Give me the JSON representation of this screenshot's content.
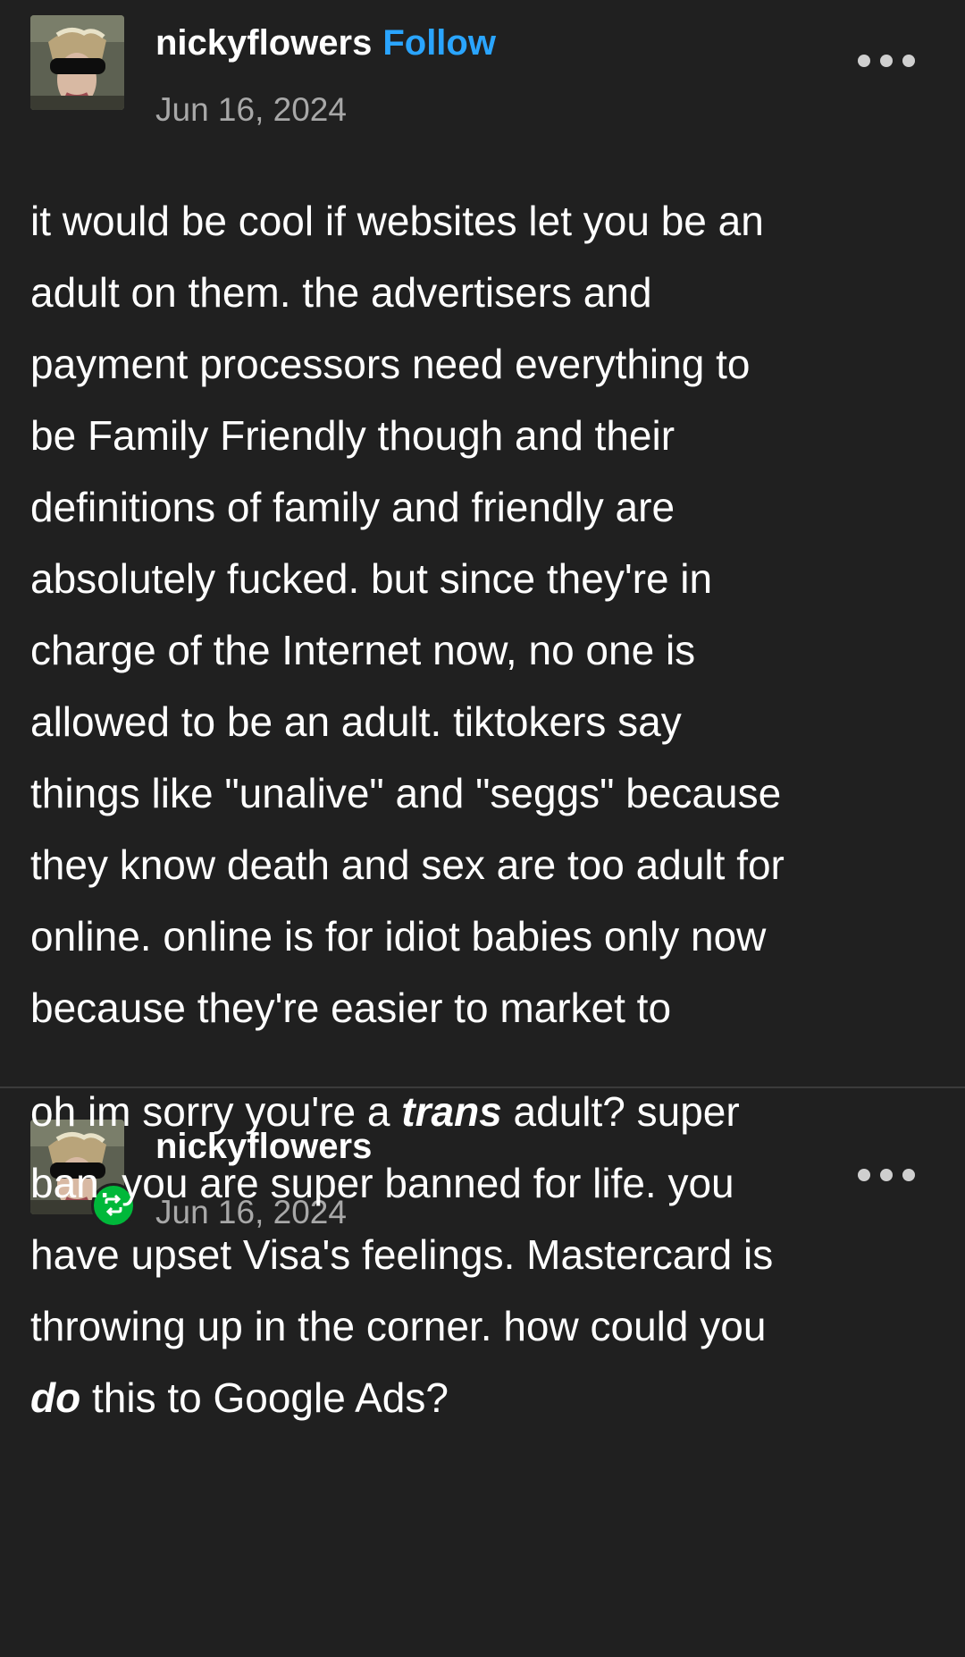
{
  "posts": [
    {
      "username": "nickyflowers",
      "follow_label": "Follow",
      "date": "Jun 16, 2024",
      "more_icon": "ellipsis-icon",
      "avatar_icon": "avatar",
      "body_lines": [
        "it would be cool if websites let you be an",
        "adult on them. the advertisers and",
        "payment processors need everything to",
        "be Family Friendly though and their",
        "definitions of family and friendly are",
        "absolutely fucked. but since they're in",
        "charge of the Internet now, no one is",
        "allowed to be an adult. tiktokers say",
        "things like \"unalive\" and \"seggs\" because",
        "they know death and sex are too adult for",
        "online. online is for idiot babies only now",
        "because they're easier to market to"
      ]
    },
    {
      "username": "nickyflowers",
      "date": "Jun 16, 2024",
      "more_icon": "ellipsis-icon",
      "reblog_icon": "reblog-icon",
      "body": {
        "l1_pre": "oh im sorry you're a ",
        "l1_em": "trans",
        "l1_post": " adult? super",
        "l2": "ban. you are super banned for life. you",
        "l3": "have upset Visa's feelings. Mastercard is",
        "l4": "throwing up in the corner. how could you",
        "l5_em": "do",
        "l5_post": " this to Google Ads?"
      }
    }
  ],
  "colors": {
    "background": "#202020",
    "follow_link": "#2aa5ff",
    "date_text": "#a8a8a8",
    "reblog_badge": "#00b83a",
    "divider": "#3b3b3b"
  }
}
